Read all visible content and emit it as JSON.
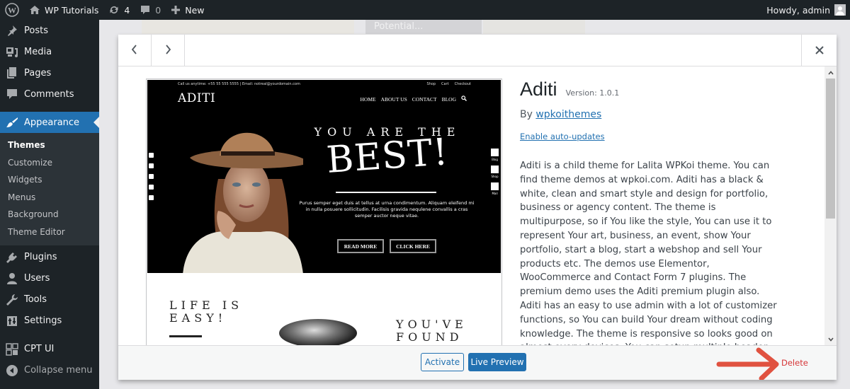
{
  "admin_bar": {
    "site_name": "WP Tutorials",
    "updates_count": "4",
    "comments_count": "0",
    "new_label": "New",
    "greeting": "Howdy, admin"
  },
  "sidebar": {
    "items": [
      {
        "label": "Posts",
        "icon": "pushpin-icon"
      },
      {
        "label": "Media",
        "icon": "media-icon"
      },
      {
        "label": "Pages",
        "icon": "pages-icon"
      },
      {
        "label": "Comments",
        "icon": "comment-icon"
      },
      {
        "label": "Appearance",
        "icon": "paintbrush-icon",
        "current": true
      },
      {
        "label": "Plugins",
        "icon": "plug-icon"
      },
      {
        "label": "Users",
        "icon": "user-icon"
      },
      {
        "label": "Tools",
        "icon": "wrench-icon"
      },
      {
        "label": "Settings",
        "icon": "settings-icon"
      },
      {
        "label": "CPT UI",
        "icon": "grid-icon"
      }
    ],
    "appearance_submenu": [
      "Themes",
      "Customize",
      "Widgets",
      "Menus",
      "Background",
      "Theme Editor"
    ],
    "active_submenu": "Themes",
    "collapse_label": "Collapse menu"
  },
  "background": {
    "card_text": "Potential..."
  },
  "modal": {
    "prev_label": "Previous theme",
    "next_label": "Next theme",
    "close_label": "Close",
    "screenshot": {
      "topline": "Call us anytime: +55 55 555 5555 | Email: notreal@yourdomain.com",
      "toplinks": [
        "Shop",
        "Cart",
        "Checkout"
      ],
      "logo": "ADITI",
      "nav": [
        "HOME",
        "ABOUT US",
        "CONTACT",
        "BLOG"
      ],
      "hero_sub": "YOU ARE THE",
      "hero_title": "BEST!",
      "hero_text": "Purus semper eget duis at tellus at urna condimentum. Aliquam eleifend mi in nulla posuere sollicitudin. Facilisis gravida nequlene convallis a cras semper auctor neque vitae.",
      "btn_read_more": "READ MORE",
      "btn_click_here": "CLICK HERE",
      "side_tools": [
        "Blog",
        "Shop",
        "Mail"
      ],
      "life_line1": "LIFE IS",
      "life_line2": "EASY!",
      "youve_line1": "YOU'VE",
      "youve_line2": "FOUND"
    },
    "theme": {
      "name": "Aditi",
      "version": "Version: 1.0.1",
      "by": "By",
      "author": "wpkoithemes",
      "auto_updates": "Enable auto-updates",
      "description": "Aditi is a child theme for Lalita WPKoi theme. You can find theme demos at wpkoi.com. Aditi has a black & white, clean and smart style and design for portfolio, business or agency content. The theme is multipurpose, so if You like the style, You can use it to represent Your art, business, an event, show Your portfolio, start a blog, start a webshop and sell Your products etc. The demos use Elementor, WooCommerce and Contact Form 7 plugins. The premium demo uses the Aditi premium plugin also. Aditi has an easy to use admin with a lot of customizer functions, so You can build Your dream without coding knowledge. The theme is responsive so looks good on almost every devices. You can setup multiple header styles."
    },
    "footer": {
      "activate": "Activate",
      "live_preview": "Live Preview",
      "delete": "Delete"
    }
  },
  "colors": {
    "accent": "#2271b1",
    "danger": "#d63638",
    "annotation_arrow": "#e05240",
    "adminbar_bg": "#1d2327"
  }
}
